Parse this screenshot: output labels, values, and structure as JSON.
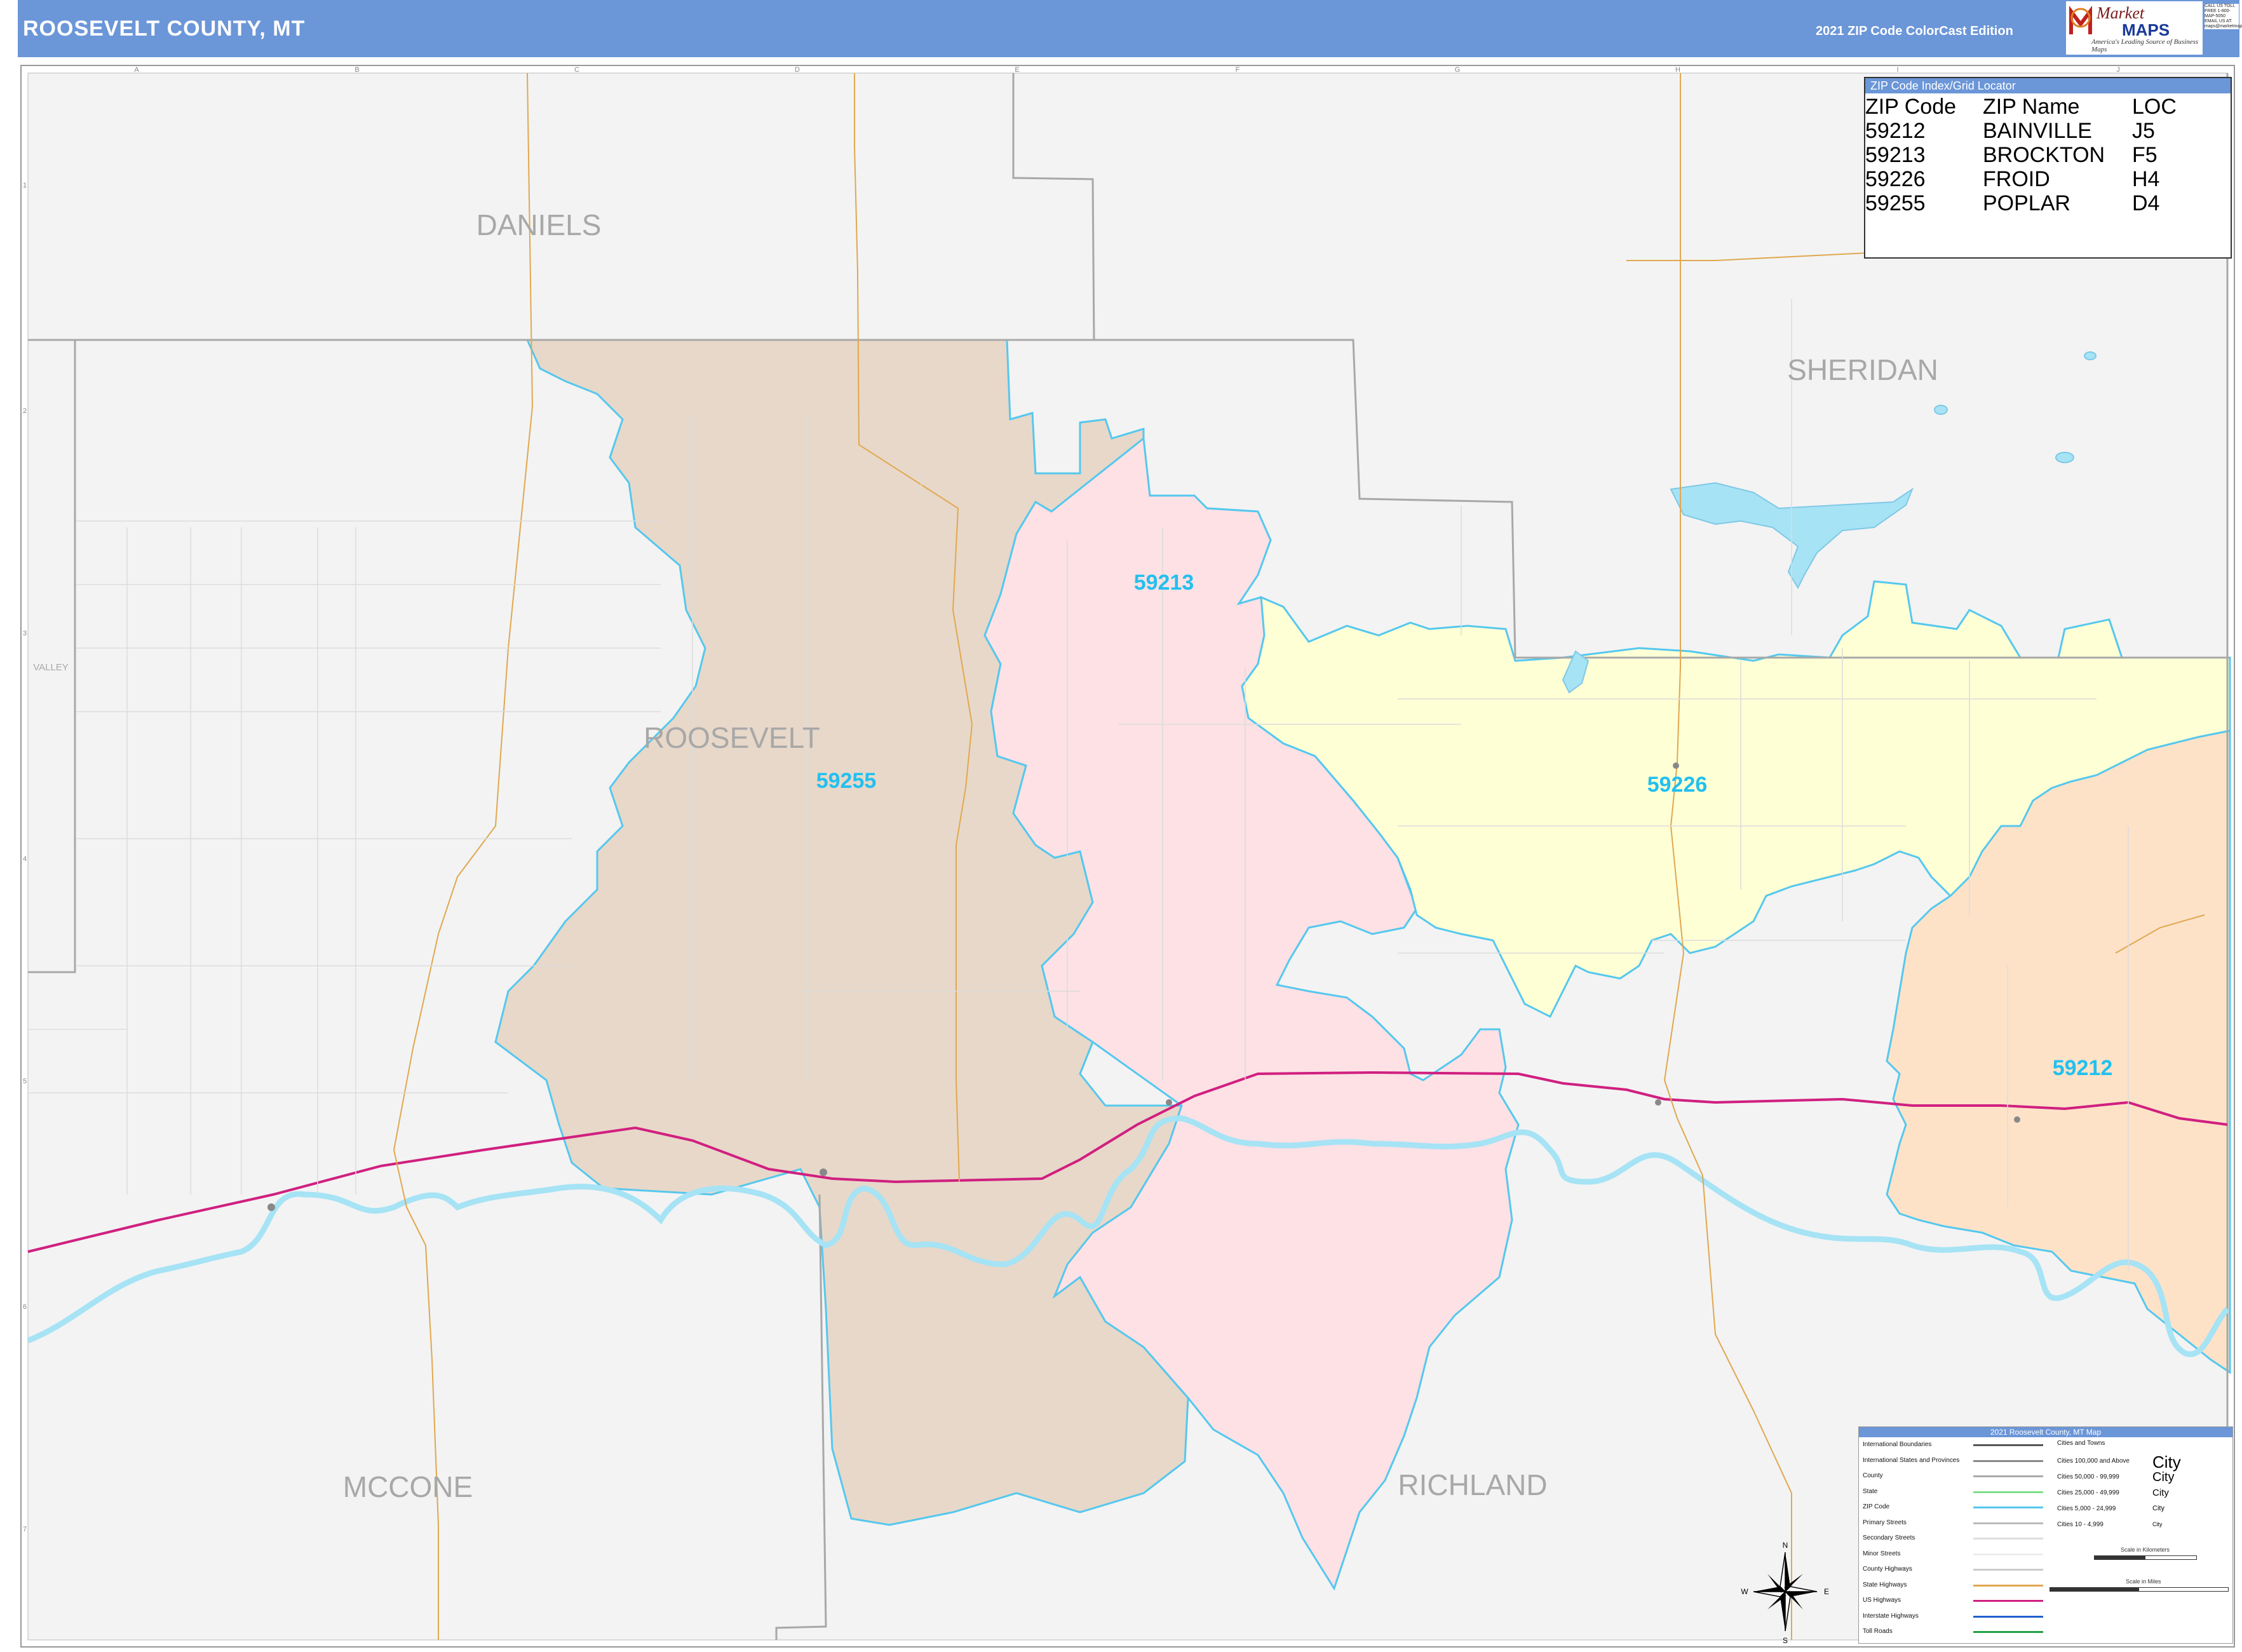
{
  "header": {
    "title": "ROOSEVELT COUNTY, MT",
    "edition": "2021 ZIP Code ColorCast Edition",
    "logo_line1": "Market",
    "logo_line2": "MAPS",
    "logo_tagline": "America's Leading Source of Business Maps",
    "contact": "CALL US TOLL FREE 1-800-MAP-5050 EMAIL US AT: maps@marketmaps.com"
  },
  "grid": {
    "columns": [
      "A",
      "B",
      "C",
      "D",
      "E",
      "F",
      "G",
      "H",
      "I",
      "J"
    ],
    "rows": [
      "1",
      "2",
      "3",
      "4",
      "5",
      "6",
      "7"
    ]
  },
  "counties": {
    "daniels": "DANIELS",
    "sheridan": "SHERIDAN",
    "roosevelt": "ROOSEVELT",
    "valley": "VALLEY",
    "mccone": "MCCONE",
    "richland": "RICHLAND"
  },
  "zip_areas": [
    {
      "zip": "59255",
      "color": "#e8d8c9"
    },
    {
      "zip": "59213",
      "color": "#fde1e5"
    },
    {
      "zip": "59226",
      "color": "#ffffd6"
    },
    {
      "zip": "59212",
      "color": "#fde2c8"
    }
  ],
  "zip_index": {
    "title": "ZIP Code Index/Grid Locator",
    "headers": [
      "ZIP Code",
      "ZIP Name",
      "LOC"
    ],
    "rows": [
      [
        "59212",
        "BAINVILLE",
        "J5"
      ],
      [
        "59213",
        "BROCKTON",
        "F5"
      ],
      [
        "59226",
        "FROID",
        "H4"
      ],
      [
        "59255",
        "POPLAR",
        "D4"
      ]
    ]
  },
  "legend": {
    "title": "2021 Roosevelt County, MT Map",
    "rows": [
      {
        "label": "International Boundaries",
        "color": "#555555"
      },
      {
        "label": "International States and Provinces",
        "color": "#888888"
      },
      {
        "label": "County",
        "color": "#aaaaaa"
      },
      {
        "label": "State",
        "color": "#7fe08a"
      },
      {
        "label": "ZIP Code",
        "color": "#55c8ee"
      },
      {
        "label": "Primary Streets",
        "color": "#bbbbbb"
      },
      {
        "label": "Secondary Streets",
        "color": "#dddddd"
      },
      {
        "label": "Minor Streets",
        "color": "#eeeeee"
      },
      {
        "label": "County Highways",
        "color": "#cccccc"
      },
      {
        "label": "State Highways",
        "color": "#e0a850"
      },
      {
        "label": "US Highways",
        "color": "#d02080"
      },
      {
        "label": "Interstate Highways",
        "color": "#2060d0"
      },
      {
        "label": "Toll Roads",
        "color": "#20a040"
      }
    ],
    "cities_header": "Cities and Towns",
    "cities": [
      {
        "label": "Cities 100,000 and Above",
        "mark": "City"
      },
      {
        "label": "Cities 50,000 - 99,999",
        "mark": "City"
      },
      {
        "label": "Cities 25,000 - 49,999",
        "mark": "City"
      },
      {
        "label": "Cities 5,000 - 24,999",
        "mark": "City"
      },
      {
        "label": "Cities 10 - 4,999",
        "mark": "City"
      }
    ],
    "scale_km": "Scale in Kilometers",
    "scale_mi": "Scale in Miles"
  },
  "compass": {
    "n": "N",
    "s": "S",
    "e": "E",
    "w": "W"
  },
  "colors": {
    "header": "#6b96d8",
    "map_bg": "#f3f3f3",
    "water": "#a6e3f5",
    "zip_label": "#22c0ee",
    "county_label": "#a8a8a8",
    "us_highway": "#d02080",
    "state_highway": "#e0a850"
  }
}
